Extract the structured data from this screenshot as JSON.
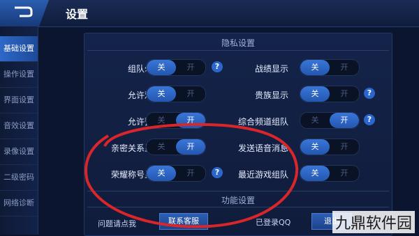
{
  "header": {
    "title": "设置"
  },
  "sidebar": {
    "items": [
      {
        "label": "基础设置",
        "active": true
      },
      {
        "label": "操作设置"
      },
      {
        "label": "界面设置"
      },
      {
        "label": "音效设置"
      },
      {
        "label": "录像设置"
      },
      {
        "label": "二级密码"
      },
      {
        "label": "网络诊断"
      }
    ]
  },
  "privacy": {
    "title": "隐私设置",
    "rows": [
      {
        "label": "组队勿扰",
        "on": "关",
        "off": "开",
        "state": "off"
      },
      {
        "label": "战绩显示",
        "on": "关",
        "off": "开",
        "state": "off"
      },
      {
        "label": "允许观战",
        "on": "关",
        "off": "开",
        "state": "off"
      },
      {
        "label": "贵族显示",
        "on": "关",
        "off": "开",
        "state": "off"
      },
      {
        "label": "允许预约",
        "on": "关",
        "off": "开",
        "state": "on"
      },
      {
        "label": "综合频道组队",
        "on": "关",
        "off": "开",
        "state": "on"
      },
      {
        "label": "亲密关系显示",
        "on": "关",
        "off": "开",
        "state": "on"
      },
      {
        "label": "发送语音消息",
        "on": "关",
        "off": "开",
        "state": "off"
      },
      {
        "label": "荣耀称号显示",
        "on": "关",
        "off": "开",
        "state": "off"
      },
      {
        "label": "最近游戏组队",
        "on": "关",
        "off": "开",
        "state": "off"
      }
    ]
  },
  "function": {
    "title": "功能设置",
    "invite_text": "问题请点我",
    "contact_label": "联系客服",
    "login_status": "已登录QQ",
    "logout_label": "退出"
  },
  "watermark": "九鼎软件园",
  "colors": {
    "accent": "#2a66cc",
    "annotation": "#d8262a"
  }
}
